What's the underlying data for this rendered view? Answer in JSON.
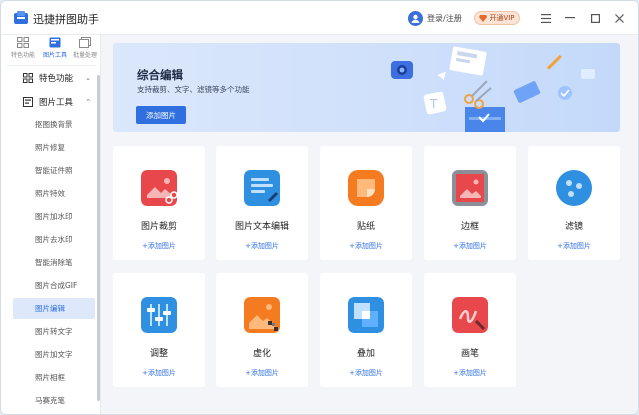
{
  "app": {
    "title": "迅捷拼图助手"
  },
  "header": {
    "login_label": "登录/注册",
    "vip_label": "开通VIP"
  },
  "window_controls": {
    "menu": "☰",
    "minimize": "−",
    "maximize": "□",
    "close": "✕"
  },
  "sidebar": {
    "tabs": [
      {
        "label": "特色功能",
        "icon": "grid-icon"
      },
      {
        "label": "图片工具",
        "icon": "image-tools-icon"
      },
      {
        "label": "批量处理",
        "icon": "batch-icon"
      }
    ],
    "categories": [
      {
        "label": "特色功能",
        "icon": "grid-icon",
        "expanded": false
      },
      {
        "label": "图片工具",
        "icon": "image-tools-icon",
        "expanded": true
      }
    ],
    "items": [
      {
        "label": "抠图换背景"
      },
      {
        "label": "照片修复"
      },
      {
        "label": "智能证件照"
      },
      {
        "label": "照片特效"
      },
      {
        "label": "图片加水印"
      },
      {
        "label": "图片去水印"
      },
      {
        "label": "智能消除笔"
      },
      {
        "label": "图片合成GIF"
      },
      {
        "label": "图片编辑"
      },
      {
        "label": "图片转文字"
      },
      {
        "label": "图片加文字"
      },
      {
        "label": "照片相框"
      },
      {
        "label": "马赛克笔"
      }
    ],
    "active_item": "图片编辑"
  },
  "banner": {
    "title": "综合编辑",
    "subtitle": "支持裁剪、文字、滤镜等多个功能",
    "button_label": "添加图片"
  },
  "tools": [
    {
      "name": "图片裁剪",
      "add_label": "+添加图片",
      "icon": "crop-icon",
      "color": "#e8474c"
    },
    {
      "name": "图片文本编辑",
      "add_label": "+添加图片",
      "icon": "text-edit-icon",
      "color": "#2f8fe0"
    },
    {
      "name": "贴纸",
      "add_label": "+添加图片",
      "icon": "sticker-icon",
      "color": "#f47b20"
    },
    {
      "name": "边框",
      "add_label": "+添加图片",
      "icon": "frame-icon",
      "color": "#e8474c"
    },
    {
      "name": "滤镜",
      "add_label": "+添加图片",
      "icon": "filter-icon",
      "color": "#2f8fe0"
    },
    {
      "name": "调整",
      "add_label": "+添加图片",
      "icon": "adjust-icon",
      "color": "#2f8fe0"
    },
    {
      "name": "虚化",
      "add_label": "+添加图片",
      "icon": "blur-icon",
      "color": "#f47b20"
    },
    {
      "name": "叠加",
      "add_label": "+添加图片",
      "icon": "overlay-icon",
      "color": "#2f8fe0"
    },
    {
      "name": "画笔",
      "add_label": "+添加图片",
      "icon": "brush-icon",
      "color": "#e8474c"
    }
  ]
}
